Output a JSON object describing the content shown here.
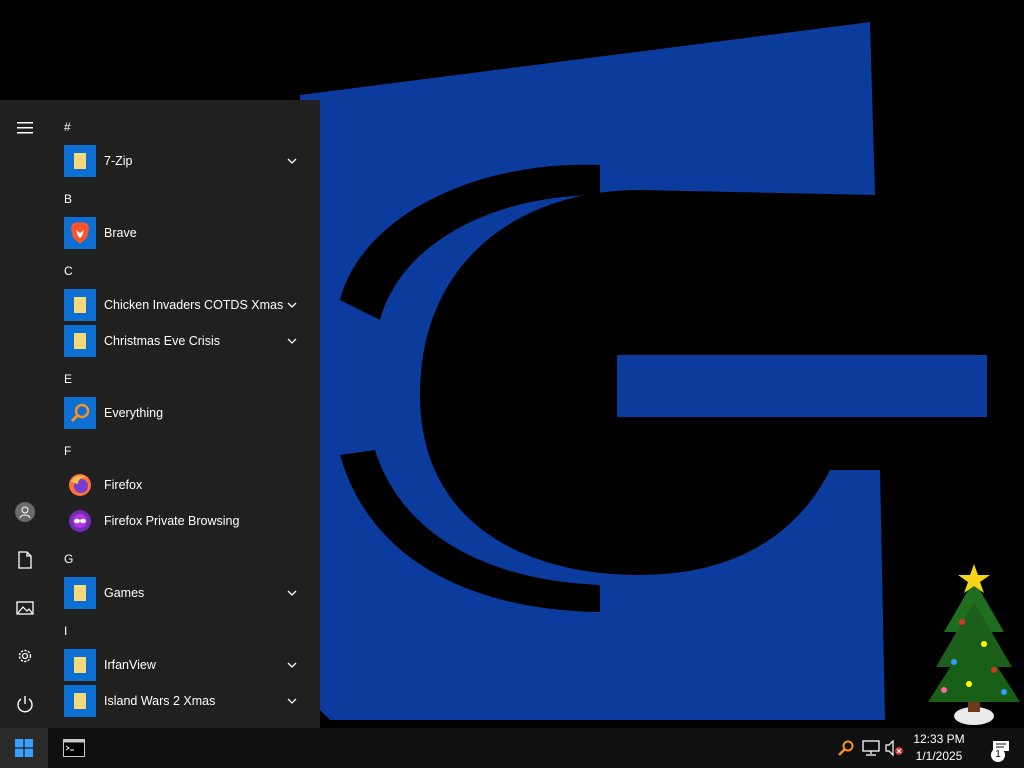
{
  "start_menu": {
    "sections": [
      {
        "letter": "#",
        "apps": [
          {
            "label": "7-Zip",
            "icon": "folder-icon",
            "expandable": true
          }
        ]
      },
      {
        "letter": "B",
        "apps": [
          {
            "label": "Brave",
            "icon": "brave-icon",
            "expandable": false
          }
        ]
      },
      {
        "letter": "C",
        "apps": [
          {
            "label": "Chicken Invaders COTDS Xmas",
            "icon": "folder-icon",
            "expandable": true
          },
          {
            "label": "Christmas Eve Crisis",
            "icon": "folder-icon",
            "expandable": true
          }
        ]
      },
      {
        "letter": "E",
        "apps": [
          {
            "label": "Everything",
            "icon": "everything-search-icon",
            "expandable": false
          }
        ]
      },
      {
        "letter": "F",
        "apps": [
          {
            "label": "Firefox",
            "icon": "firefox-icon",
            "expandable": false
          },
          {
            "label": "Firefox Private Browsing",
            "icon": "firefox-private-icon",
            "expandable": false
          }
        ]
      },
      {
        "letter": "G",
        "apps": [
          {
            "label": "Games",
            "icon": "folder-icon",
            "expandable": true
          }
        ]
      },
      {
        "letter": "I",
        "apps": [
          {
            "label": "IrfanView",
            "icon": "folder-icon",
            "expandable": true
          },
          {
            "label": "Island Wars 2 Xmas",
            "icon": "folder-icon",
            "expandable": true
          }
        ]
      }
    ],
    "rail_icons": [
      "hamburger-menu-icon",
      "user-avatar-icon",
      "documents-icon",
      "pictures-icon",
      "settings-gear-icon",
      "power-icon"
    ]
  },
  "taskbar": {
    "clock": {
      "time": "12:33 PM",
      "date": "1/1/2025"
    },
    "notification_count": "1",
    "tray_icons": [
      "everything-search-icon",
      "network-icon",
      "volume-muted-icon"
    ]
  },
  "colors": {
    "accent": "#0b6fd3",
    "start_menu_bg": "#202020",
    "taskbar_bg": "#101010",
    "wallpaper_blue": "#0c3b9e"
  }
}
